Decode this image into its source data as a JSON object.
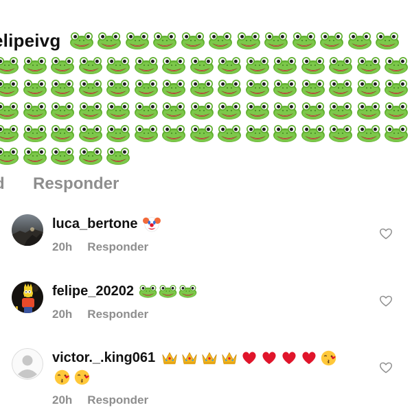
{
  "top_comment": {
    "username": "elipeivg",
    "frog_rows": [
      12,
      15,
      15,
      15,
      15,
      5
    ],
    "emoji": "frog-icon"
  },
  "top_meta": {
    "time": "d",
    "reply_label": "Responder"
  },
  "replies": [
    {
      "username": "luca_bertone",
      "emojis": [
        "clown-face-icon"
      ],
      "time": "20h",
      "reply_label": "Responder",
      "avatar": "avatar-dark-landscape",
      "liked": false
    },
    {
      "username": "felipe_20202",
      "emojis": [
        "frog-icon",
        "frog-icon",
        "frog-icon"
      ],
      "time": "20h",
      "reply_label": "Responder",
      "avatar": "avatar-cartoon-character",
      "liked": false
    },
    {
      "username": "victor._.king061",
      "emojis": [
        "crown-icon",
        "crown-icon",
        "crown-icon",
        "crown-icon",
        "red-heart-icon",
        "red-heart-icon",
        "red-heart-icon",
        "red-heart-icon",
        "kiss-face-icon",
        "kiss-face-icon",
        "kiss-face-icon"
      ],
      "time": "20h",
      "reply_label": "Responder",
      "avatar": "default-avatar",
      "liked": false
    }
  ],
  "colors": {
    "secondary_text": "#8e8e8e",
    "frog_green": "#6fbf3a",
    "heart_red": "#e0152b",
    "crown_gold": "#f3b51c"
  }
}
